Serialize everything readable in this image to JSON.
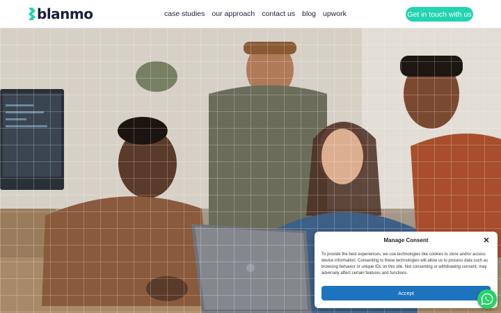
{
  "brand": {
    "name": "blanmo",
    "accent_color": "#22d3b0",
    "text_color": "#1b1f3b"
  },
  "nav": {
    "items": [
      {
        "label": "case studies"
      },
      {
        "label": "our approach"
      },
      {
        "label": "contact us"
      },
      {
        "label": "blog"
      },
      {
        "label": "upwork"
      }
    ],
    "cta_label": "Get in touch with us"
  },
  "hero": {
    "image": "team-of-four-looking-at-laptop-photo"
  },
  "consent": {
    "title": "Manage Consent",
    "body": "To provide the best experiences, we use technologies like cookies to store and/or access device information. Consenting to these technologies will allow us to process data such as browsing behavior or unique IDs on this site. Not consenting or withdrawing consent, may adversely affect certain features and functions.",
    "accept_label": "Accept",
    "accept_color": "#1e73be"
  },
  "widgets": {
    "whatsapp_icon": "whatsapp-icon",
    "whatsapp_color": "#25d366"
  }
}
